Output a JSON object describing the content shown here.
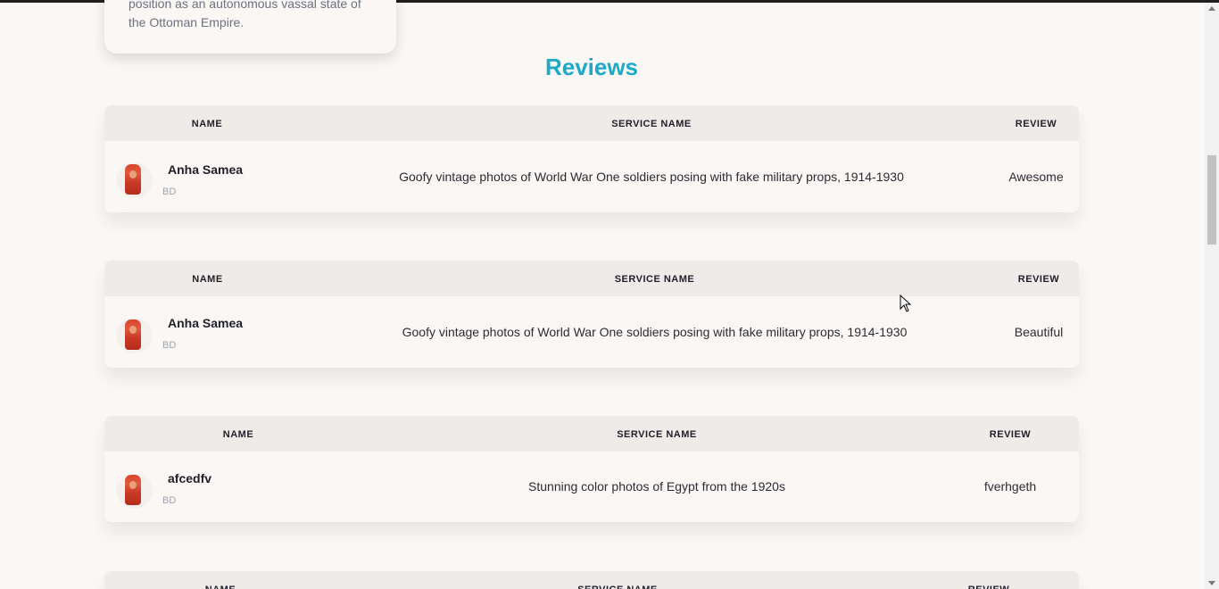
{
  "card": {
    "text_line1": "position as an autonomous vassal state of",
    "text_line2": "the Ottoman Empire."
  },
  "reviews_section": {
    "title": "Reviews",
    "headers": {
      "name": "NAME",
      "service": "SERVICE NAME",
      "review": "REVIEW"
    },
    "rows": [
      {
        "name": "Anha Samea",
        "country": "BD",
        "service": "Goofy vintage photos of World War One soldiers posing with fake military props, 1914-1930",
        "review": "Awesome"
      },
      {
        "name": "Anha Samea",
        "country": "BD",
        "service": "Goofy vintage photos of World War One soldiers posing with fake military props, 1914-1930",
        "review": "Beautiful"
      },
      {
        "name": "afcedfv",
        "country": "BD",
        "service": "Stunning color photos of Egypt from the 1920s",
        "review": "fverhgeth"
      },
      {
        "name": "",
        "country": "",
        "service": "",
        "review": ""
      }
    ]
  },
  "colors": {
    "accent": "#1fa9c8",
    "background": "#faf7f5",
    "table_header": "#efebe8"
  },
  "icons": {
    "avatar": "user-avatar-photo",
    "cursor": "mouse-pointer-icon"
  }
}
